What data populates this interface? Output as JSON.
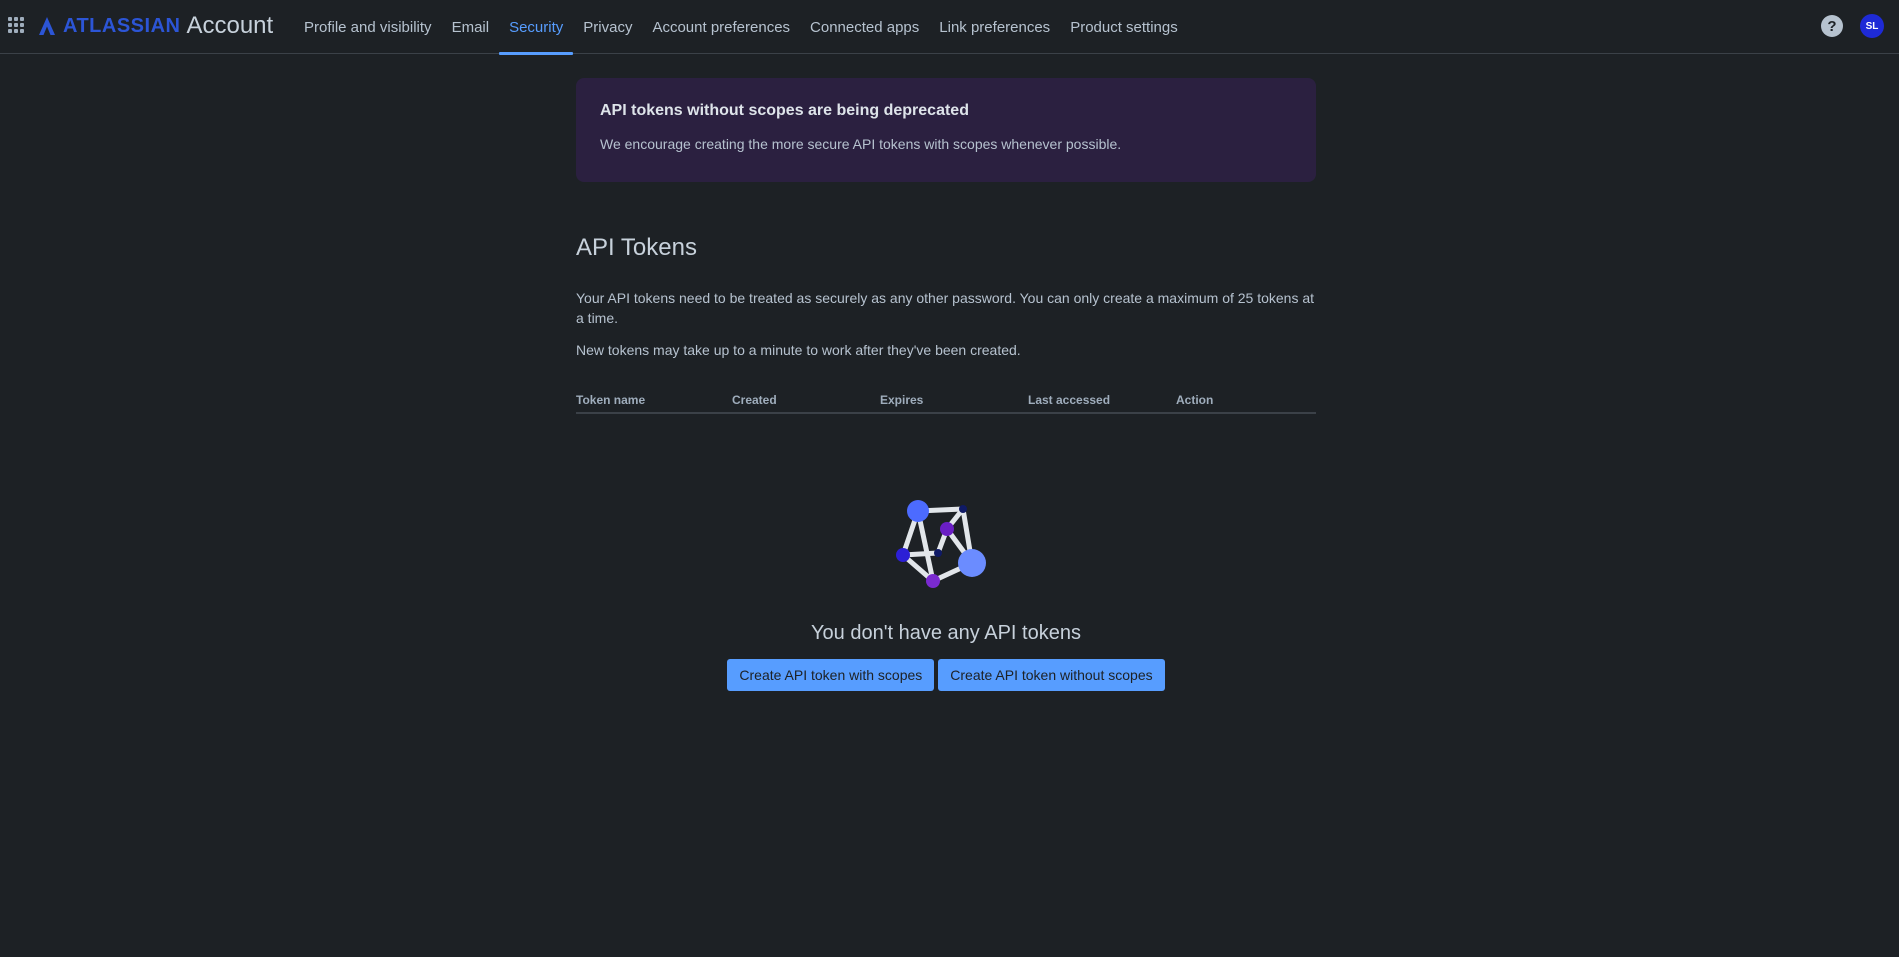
{
  "header": {
    "brand_name": "ATLASSIAN",
    "product_name": "Account",
    "nav": [
      {
        "label": "Profile and visibility",
        "active": false
      },
      {
        "label": "Email",
        "active": false
      },
      {
        "label": "Security",
        "active": true
      },
      {
        "label": "Privacy",
        "active": false
      },
      {
        "label": "Account preferences",
        "active": false
      },
      {
        "label": "Connected apps",
        "active": false
      },
      {
        "label": "Link preferences",
        "active": false
      },
      {
        "label": "Product settings",
        "active": false
      }
    ],
    "help_label": "?",
    "avatar_initials": "SL",
    "icons": {
      "app_switcher": "app-switcher-icon",
      "brand": "atlassian-logo-icon",
      "help": "help-icon"
    }
  },
  "banner": {
    "title": "API tokens without scopes are being deprecated",
    "body": "We encourage creating the more secure API tokens with scopes whenever possible."
  },
  "page": {
    "title": "API Tokens",
    "description_1": "Your API tokens need to be treated as securely as any other password. You can only create a maximum of 25 tokens at a time.",
    "description_2": "New tokens may take up to a minute to work after they've been created."
  },
  "table": {
    "columns": [
      "Token name",
      "Created",
      "Expires",
      "Last accessed",
      "Action"
    ]
  },
  "empty_state": {
    "title": "You don't have any API tokens",
    "illustration": "network-nodes-illustration",
    "buttons": [
      "Create API token with scopes",
      "Create API token without scopes"
    ]
  },
  "colors": {
    "background": "#1d2125",
    "accent": "#579dff",
    "brand": "#2c55d6",
    "banner_bg": "#2b2040",
    "avatar_bg": "#1e2ad6"
  }
}
